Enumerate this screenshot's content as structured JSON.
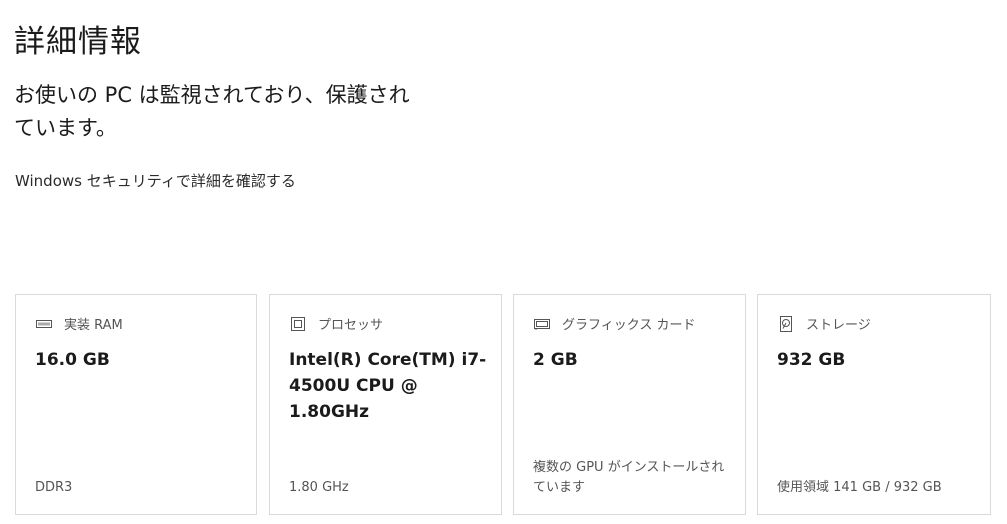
{
  "header": {
    "title": "詳細情報"
  },
  "status": {
    "message": "お使いの PC は監視されており、保護されています。"
  },
  "links": {
    "security": "Windows セキュリティで詳細を確認する"
  },
  "cards": [
    {
      "icon": "ram-icon",
      "label": "実装 RAM",
      "value": "16.0 GB",
      "footer": "DDR3"
    },
    {
      "icon": "processor-icon",
      "label": "プロセッサ",
      "value": "Intel(R) Core(TM) i7-4500U CPU @ 1.80GHz",
      "footer": "1.80 GHz"
    },
    {
      "icon": "graphics-card-icon",
      "label": "グラフィックス カード",
      "value": "2 GB",
      "footer": "複数の GPU がインストールされています"
    },
    {
      "icon": "storage-icon",
      "label": "ストレージ",
      "value": "932 GB",
      "footer": "使用領域 141 GB / 932 GB"
    }
  ],
  "colors": {
    "text": "#1b1b1b",
    "secondary_text": "#555555",
    "card_border": "#d9d9d9",
    "background": "#ffffff"
  }
}
